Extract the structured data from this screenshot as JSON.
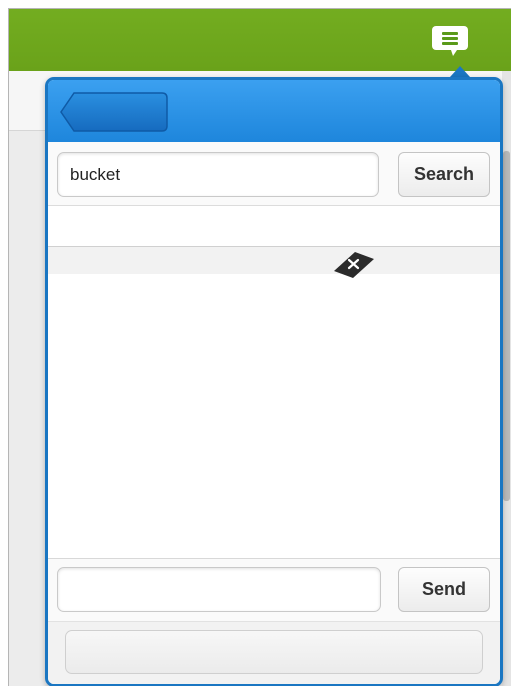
{
  "app_header": {
    "chat_icon": "chat-bubble-lines-icon",
    "brand_color": "#6aa21a"
  },
  "chat_popup": {
    "accent_color": "#1a76c2",
    "back_icon": "back-arrow-icon",
    "search": {
      "value": "bucket",
      "placeholder": "",
      "button_label": "Search"
    },
    "results": {
      "clear_icon": "close-x-icon"
    },
    "compose": {
      "value": "",
      "placeholder": "",
      "send_label": "Send"
    },
    "status_text": ""
  }
}
